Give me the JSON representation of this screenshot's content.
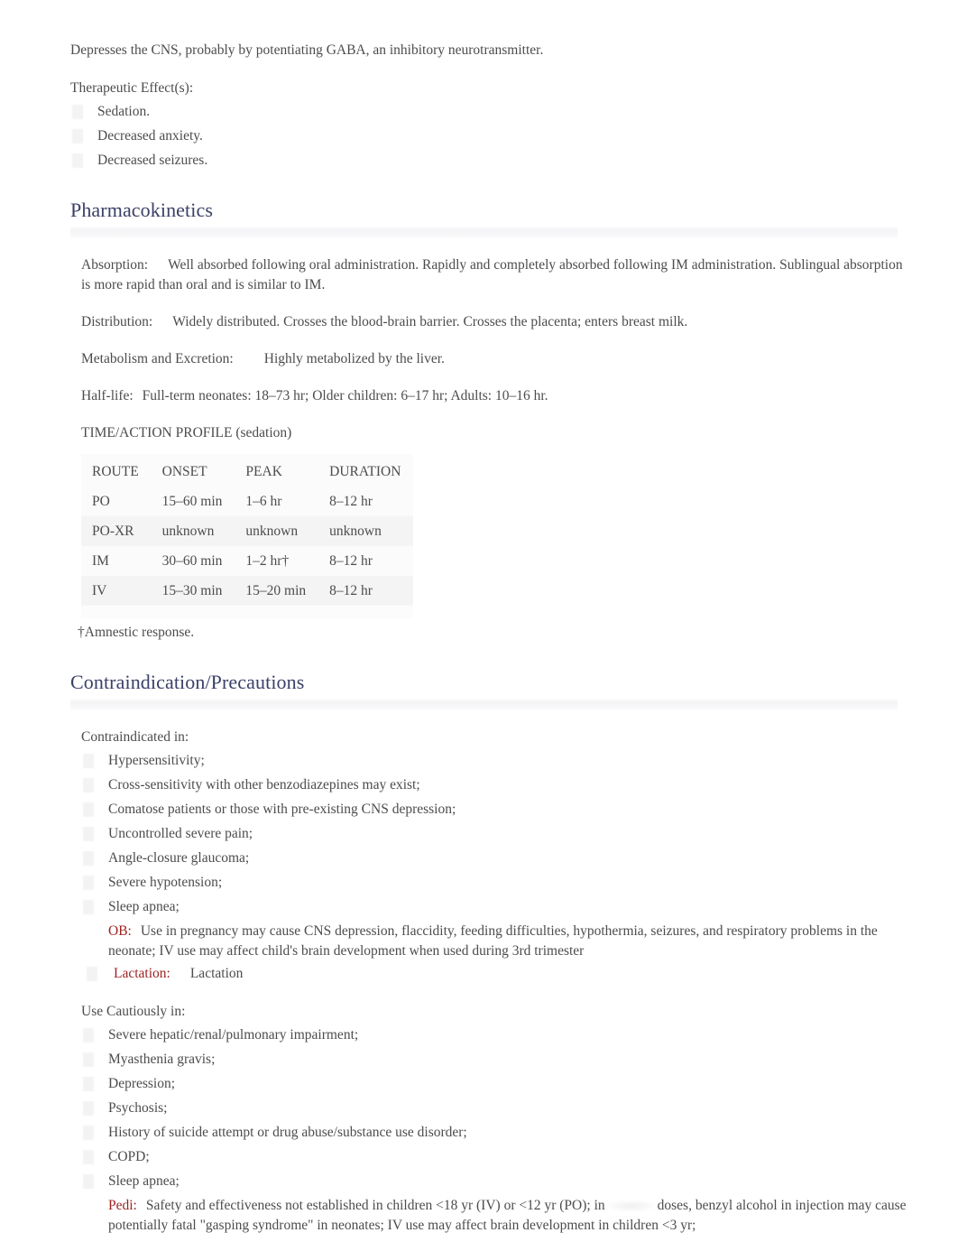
{
  "document": {
    "intro_paragraph": "Depresses the CNS, probably by potentiating GABA, an inhibitory neurotransmitter.",
    "therapeutic_effects_label": "Therapeutic Effect(s):",
    "therapeutic_effects": [
      "Sedation.",
      "Decreased anxiety.",
      "Decreased seizures."
    ]
  },
  "pharmacokinetics": {
    "heading": "Pharmacokinetics",
    "absorption_label": "Absorption:",
    "absorption_text": "Well absorbed following oral administration. Rapidly and completely absorbed following IM administration. Sublingual absorption is more rapid than oral and is similar to IM.",
    "distribution_label": "Distribution:",
    "distribution_text": "Widely distributed. Crosses the blood-brain barrier. Crosses the placenta; enters breast milk.",
    "metabolism_label": "Metabolism and Excretion:",
    "metabolism_text": "Highly metabolized by the liver.",
    "halflife_label": "Half-life:",
    "halflife_text": "Full-term neonates: 18–73 hr; Older children: 6–17 hr; Adults: 10–16 hr.",
    "table_title": "TIME/ACTION PROFILE (sedation)",
    "table": {
      "headers": [
        "ROUTE",
        "ONSET",
        "PEAK",
        "DURATION"
      ],
      "rows": [
        [
          "PO",
          "15–60 min",
          "1–6 hr",
          "8–12 hr"
        ],
        [
          "PO-XR",
          "unknown",
          "unknown",
          "unknown"
        ],
        [
          "IM",
          "30–60 min",
          "1–2 hr†",
          "8–12 hr"
        ],
        [
          "IV",
          "15–30 min",
          "15–20 min",
          "8–12 hr"
        ]
      ]
    },
    "table_footnote": "†Amnestic response."
  },
  "contraindications": {
    "heading": "Contraindication/Precautions",
    "contraindicated_label": "Contraindicated in:",
    "contraindicated_items": [
      "Hypersensitivity;",
      "Cross-sensitivity with other benzodiazepines may exist;",
      "Comatose patients or those with pre-existing CNS depression;",
      "Uncontrolled severe pain;",
      "Angle-closure glaucoma;",
      "Severe hypotension;",
      "Sleep apnea;"
    ],
    "ob_label": "OB:",
    "ob_text": "Use in pregnancy may cause CNS depression, flaccidity, feeding difficulties, hypothermia, seizures, and respiratory problems in the neonate; IV use may affect child's brain development when used during 3rd trimester",
    "lactation_label": "Lactation:",
    "lactation_text": "Lactation",
    "cautiously_label": "Use Cautiously in:",
    "cautiously_items": [
      "Severe hepatic/renal/pulmonary impairment;",
      "Myasthenia gravis;",
      "Depression;",
      "Psychosis;",
      "History of suicide attempt or drug abuse/substance use disorder;",
      "COPD;",
      "Sleep apnea;"
    ],
    "pedi_label": "Pedi:",
    "pedi_text_part1": "Safety and effectiveness not established in children <18 yr (IV) or <12 yr (PO); in",
    "pedi_text_part2": "doses, benzyl alcohol in injection may cause potentially fatal \"gasping syndrome\" in neonates; IV use may affect brain development in children <3 yr;"
  },
  "colors": {
    "heading": "#3b4068",
    "body_text": "#4c4c4c",
    "alert_label": "#9e2222",
    "rule_band": "#f3f3f5",
    "table_shade": "#f4f4f5"
  }
}
